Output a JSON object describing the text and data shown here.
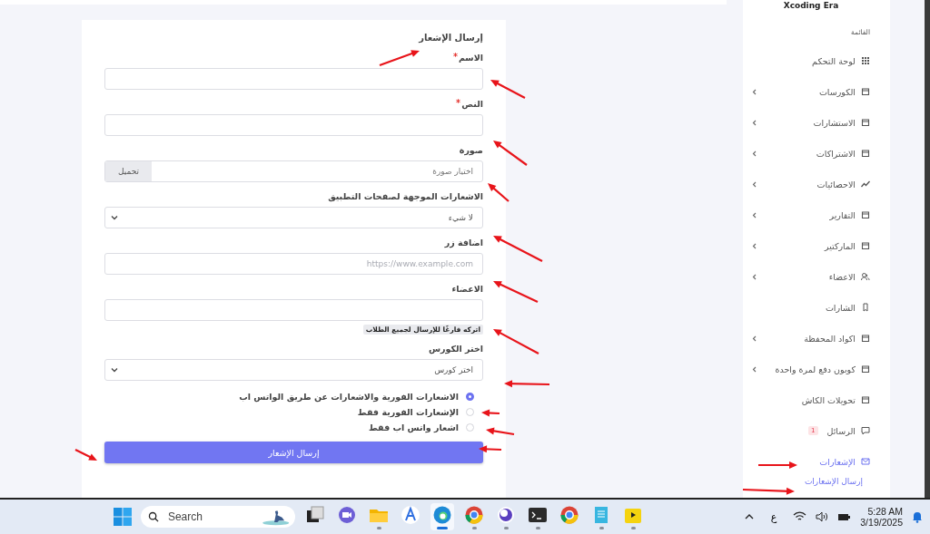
{
  "app_name": "Xcoding Era",
  "sidebar": {
    "section_title": "القائمة",
    "items": [
      {
        "label": "لوحة التحكم",
        "submenu": false,
        "selected": false
      },
      {
        "label": "الكورسات",
        "submenu": true,
        "selected": false
      },
      {
        "label": "الاستشارات",
        "submenu": true,
        "selected": false
      },
      {
        "label": "الاشتراكات",
        "submenu": true,
        "selected": false
      },
      {
        "label": "الاحصائيات",
        "submenu": true,
        "selected": false
      },
      {
        "label": "التقارير",
        "submenu": true,
        "selected": false
      },
      {
        "label": "الماركتير",
        "submenu": true,
        "selected": false
      },
      {
        "label": "الاعضاء",
        "submenu": true,
        "selected": false
      },
      {
        "label": "الشارات",
        "submenu": false,
        "selected": false
      },
      {
        "label": "اكواد المحفظة",
        "submenu": true,
        "selected": false
      },
      {
        "label": "كوبون دفع لمرة واحدة",
        "submenu": true,
        "selected": false
      },
      {
        "label": "تحويلات الكاش",
        "submenu": false,
        "selected": false
      },
      {
        "label": "الرسائل",
        "submenu": false,
        "selected": false,
        "badge": "1"
      },
      {
        "label": "الإشعارات",
        "submenu": false,
        "selected": true,
        "children": [
          {
            "label": "إرسال الإشعارات",
            "selected": true
          }
        ]
      }
    ]
  },
  "form": {
    "title": "إرسال الإشعار",
    "fields": [
      {
        "kind": "text",
        "label": "الاسم",
        "required": true
      },
      {
        "kind": "text",
        "label": "النص",
        "required": true
      },
      {
        "kind": "file",
        "label": "صورة",
        "required": false,
        "placeholder": "اختيار صورة",
        "button": "تحميل"
      },
      {
        "kind": "select",
        "label": "الاشعارات الموجهة لصفحات التطبيق",
        "required": false,
        "value": "لا شيء"
      },
      {
        "kind": "text",
        "label": "اضافة زر",
        "required": false,
        "placeholder": "https://www.example.com"
      },
      {
        "kind": "text",
        "label": "الاعضاء",
        "required": false,
        "hint": "اتركه فارغًا للإرسال لجميع الطلاب"
      },
      {
        "kind": "select",
        "label": "اختر الكورس",
        "required": false,
        "value": "اختر كورس"
      }
    ],
    "radios": [
      {
        "label": "الاشعارات الفورية والاشعارات عن طريق الواتس اب",
        "selected": true
      },
      {
        "label": "الإشعارات الفورية فقط",
        "selected": false
      },
      {
        "label": "اشعار واتس اب فقط",
        "selected": false
      }
    ],
    "submit": "إرسال الإشعار"
  },
  "taskbar": {
    "search_placeholder": "Search",
    "apps": [
      {
        "running": false,
        "selected": false
      },
      {
        "running": false,
        "selected": false
      },
      {
        "running": true,
        "selected": false
      },
      {
        "running": false,
        "selected": false
      },
      {
        "running": true,
        "selected": true
      },
      {
        "running": true,
        "selected": false
      },
      {
        "running": true,
        "selected": false
      },
      {
        "running": true,
        "selected": false
      },
      {
        "running": false,
        "selected": false
      },
      {
        "running": true,
        "selected": false
      },
      {
        "running": true,
        "selected": false
      }
    ],
    "language": "ع",
    "time": "5:28 AM",
    "date": "3/19/2025"
  }
}
